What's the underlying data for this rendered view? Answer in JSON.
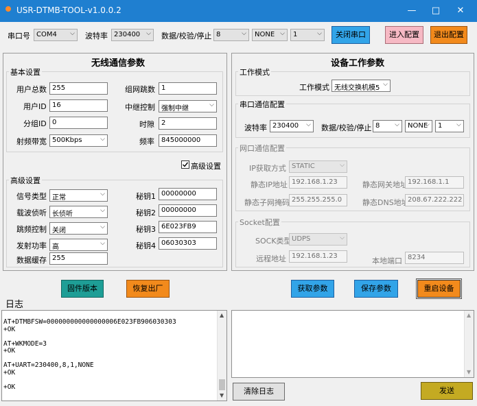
{
  "window": {
    "title": "USR-DTMB-TOOL-v1.0.0.2",
    "minimize": "—",
    "maximize": "□",
    "close": "✕"
  },
  "toolbar": {
    "port_label": "串口号",
    "port_value": "COM4",
    "baud_label": "波特率",
    "baud_value": "230400",
    "dps_label": "数据/校验/停止",
    "data_bits": "8",
    "parity": "NONE",
    "stop_bits": "1",
    "close_port_button": "关闭串口",
    "enter_config_button": "进入配置",
    "exit_config_button": "退出配置"
  },
  "wireless": {
    "title": "无线通信参数",
    "basic_title": "基本设置",
    "user_total_label": "用户总数",
    "user_total": "255",
    "net_hops_label": "组网跳数",
    "net_hops": "1",
    "user_id_label": "用户ID",
    "user_id": "16",
    "relay_label": "中继控制",
    "relay_value": "强制中继",
    "group_id_label": "分组ID",
    "group_id": "0",
    "slot_label": "时隙",
    "slot": "2",
    "bandwidth_label": "射频带宽",
    "bandwidth": "500Kbps",
    "freq_label": "频率",
    "freq": "845000000",
    "advanced_checkbox": "高级设置",
    "advanced_title": "高级设置",
    "signal_type_label": "信号类型",
    "signal_type": "正常",
    "key1_label": "秘钥1",
    "key1": "00000000",
    "listen_label": "载波侦听",
    "listen": "长侦听",
    "key2_label": "秘钥2",
    "key2": "00000000",
    "hop_label": "跳频控制",
    "hop": "关闭",
    "key3_label": "秘钥3",
    "key3": "6E023FB9",
    "power_label": "发射功率",
    "power": "高",
    "key4_label": "秘钥4",
    "key4": "06030303",
    "buffer_label": "数据缓存",
    "buffer": "255"
  },
  "device": {
    "title": "设备工作参数",
    "mode_group": "工作模式",
    "mode_label": "工作模式",
    "mode_value": "无线交换机模5",
    "uart_group": "串口通信配置",
    "baud_label": "波特率",
    "baud_value": "230400",
    "dps_label": "数据/校验/停止",
    "data_bits": "8",
    "parity": "NONE",
    "stop_bits": "1",
    "net_group": "网口通信配置",
    "ip_mode_label": "IP获取方式",
    "ip_mode": "STATIC",
    "static_ip_label": "静态IP地址",
    "static_ip": "192.168.1.23",
    "gateway_label": "静态网关地址",
    "gateway": "192.168.1.1",
    "mask_label": "静态子网掩码",
    "mask": "255.255.255.0",
    "dns_label": "静态DNS地址",
    "dns": "208.67.222.222",
    "socket_group": "Socket配置",
    "sock_type_label": "SOCK类型",
    "sock_type": "UDPS",
    "remote_label": "远程地址",
    "remote": "192.168.1.23",
    "local_port_label": "本地端口",
    "local_port": "8234"
  },
  "buttons": {
    "firmware": "固件版本",
    "factory": "恢复出厂",
    "get_params": "获取参数",
    "save_params": "保存参数",
    "restart": "重启设备",
    "clear_log": "清除日志",
    "send": "发送"
  },
  "log": {
    "title": "日志",
    "lines": "AT+DTMBFSW=000000000000000006E023FB906030303\n+OK\n\nAT+WKMODE=3\n+OK\n\nAT+UART=230400,8,1,NONE\n+OK\n\n+OK"
  },
  "colors": {
    "titlebar": "#1f7fd0",
    "btn_blue": "#32a4e8",
    "btn_teal": "#1e9e96",
    "btn_orange": "#f28a1c",
    "btn_pink": "#f6b9c4",
    "btn_olive": "#c4aa22"
  }
}
